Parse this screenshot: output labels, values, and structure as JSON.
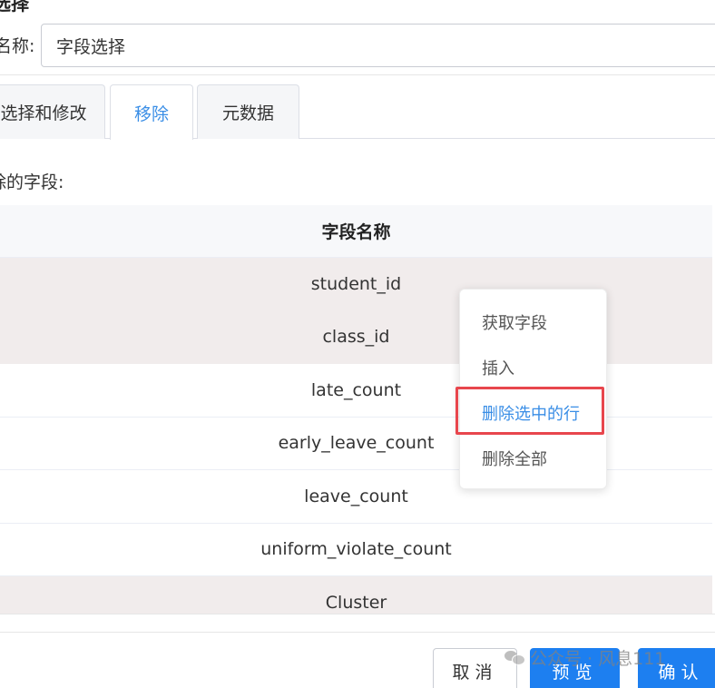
{
  "dialog": {
    "title": "选择"
  },
  "name_field": {
    "label": "名称:",
    "value": "字段选择"
  },
  "tabs": [
    {
      "label": "选择和修改",
      "active": false
    },
    {
      "label": "移除",
      "active": true
    },
    {
      "label": "元数据",
      "active": false
    }
  ],
  "section_label": "除的字段:",
  "table": {
    "header": "字段名称",
    "rows": [
      {
        "value": "student_id",
        "selected": true
      },
      {
        "value": "class_id",
        "selected": true
      },
      {
        "value": "late_count",
        "selected": false
      },
      {
        "value": "early_leave_count",
        "selected": false
      },
      {
        "value": "leave_count",
        "selected": false
      },
      {
        "value": "uniform_violate_count",
        "selected": false
      },
      {
        "value": "Cluster",
        "selected": true
      }
    ]
  },
  "context_menu": {
    "items": [
      {
        "label": "获取字段"
      },
      {
        "label": "插入"
      },
      {
        "label": "删除选中的行",
        "highlighted": true
      },
      {
        "label": "删除全部"
      }
    ]
  },
  "buttons": {
    "cancel": "取消",
    "preview": "预览",
    "confirm": "确认"
  },
  "watermark": {
    "text": "公众号 · 风息111"
  },
  "colors": {
    "accent": "#1d7ff0",
    "active_tab_text": "#3a8ee6",
    "highlight_border": "#e8464d",
    "selected_row": "#f1ecec"
  }
}
